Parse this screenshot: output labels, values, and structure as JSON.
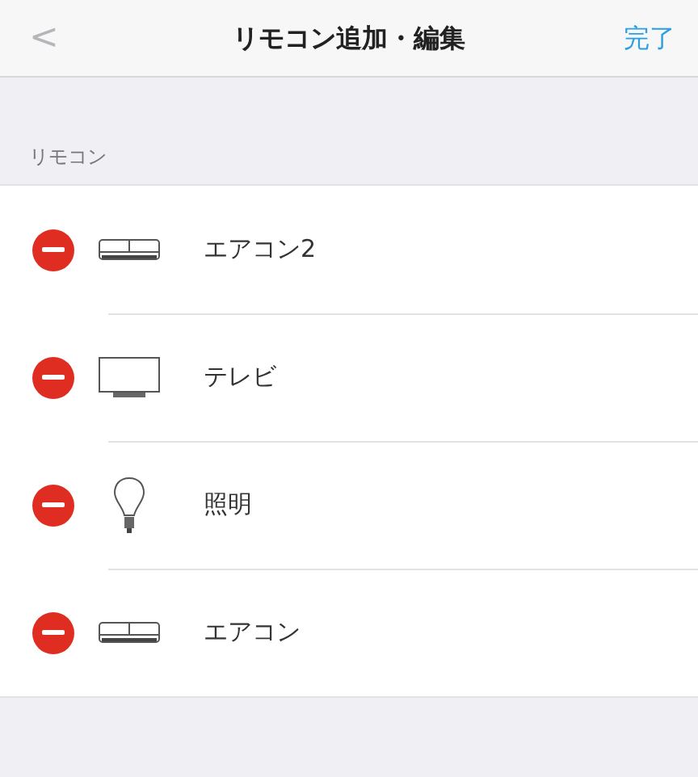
{
  "nav": {
    "back": "<",
    "title": "リモコン追加・編集",
    "done": "完了"
  },
  "section": {
    "header": "リモコン"
  },
  "remotes": [
    {
      "kind": "aircon",
      "label": "エアコン2"
    },
    {
      "kind": "tv",
      "label": "テレビ"
    },
    {
      "kind": "light",
      "label": "照明"
    },
    {
      "kind": "aircon",
      "label": "エアコン"
    }
  ]
}
